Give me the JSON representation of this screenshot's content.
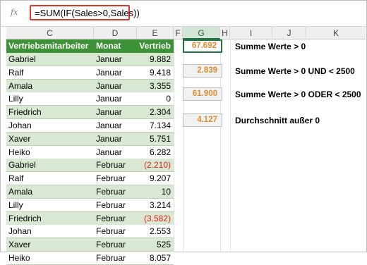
{
  "formula_bar": {
    "fx_label": "fx",
    "formula": "=SUM(IF(Sales>0,Sales))"
  },
  "columns": [
    "C",
    "D",
    "E",
    "F",
    "G",
    "H",
    "I",
    "J",
    "K"
  ],
  "table": {
    "headers": [
      "Vertriebsmitarbeiter",
      "Monat",
      "Vertrieb"
    ],
    "rows": [
      {
        "name": "Gabriel",
        "month": "Januar",
        "sales": "9.882"
      },
      {
        "name": "Ralf",
        "month": "Januar",
        "sales": "9.418"
      },
      {
        "name": "Amala",
        "month": "Januar",
        "sales": "3.355"
      },
      {
        "name": "Lilly",
        "month": "Januar",
        "sales": "0"
      },
      {
        "name": "Friedrich",
        "month": "Januar",
        "sales": "2.304"
      },
      {
        "name": "Johan",
        "month": "Januar",
        "sales": "7.134"
      },
      {
        "name": "Xaver",
        "month": "Januar",
        "sales": "5.751"
      },
      {
        "name": "Heiko",
        "month": "Januar",
        "sales": "6.282"
      },
      {
        "name": "Gabriel",
        "month": "Februar",
        "sales": "(2.210)"
      },
      {
        "name": "Ralf",
        "month": "Februar",
        "sales": "9.207"
      },
      {
        "name": "Amala",
        "month": "Februar",
        "sales": "10"
      },
      {
        "name": "Lilly",
        "month": "Februar",
        "sales": "3.214"
      },
      {
        "name": "Friedrich",
        "month": "Februar",
        "sales": "(3.582)"
      },
      {
        "name": "Johan",
        "month": "Februar",
        "sales": "2.553"
      },
      {
        "name": "Xaver",
        "month": "Februar",
        "sales": "525"
      },
      {
        "name": "Heiko",
        "month": "Februar",
        "sales": "8.057"
      }
    ]
  },
  "results": [
    {
      "value": "67.692",
      "label": "Summe Werte > 0"
    },
    {
      "value": "2.839",
      "label": "Summe Werte > 0 UND < 2500"
    },
    {
      "value": "61.900",
      "label": "Summe Werte > 0 ODER < 2500"
    },
    {
      "value": "4.127",
      "label": "Durchschnitt außer 0"
    }
  ],
  "colors": {
    "header_green": "#3d9137",
    "band_green": "#d8e8d2",
    "negative_red": "#e0201b",
    "result_orange": "#e28b33",
    "formula_box_red": "#e3352b"
  }
}
